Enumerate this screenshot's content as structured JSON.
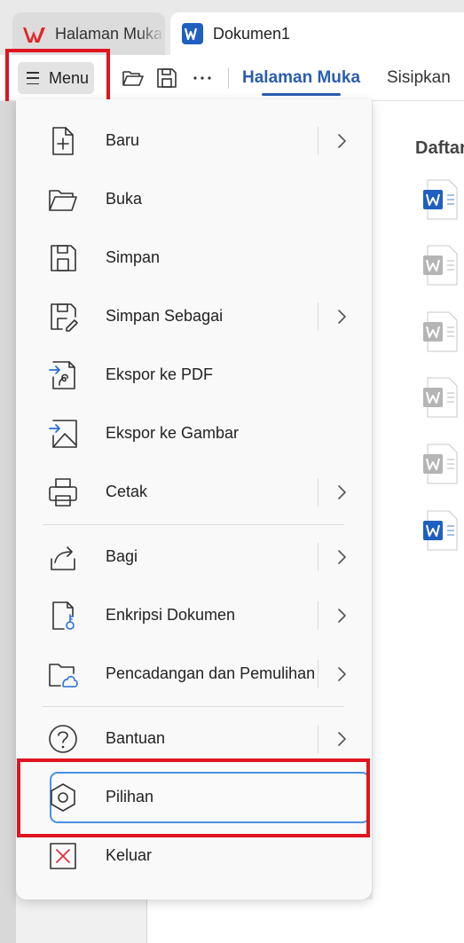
{
  "tabs": [
    {
      "label": "Halaman Muka",
      "state": "inactive",
      "icon": "wps-logo-icon"
    },
    {
      "label": "Dokumen1",
      "state": "active",
      "icon": "word-doc-icon"
    }
  ],
  "toolbar": {
    "menu_label": "Menu",
    "icons": [
      "open-folder-icon",
      "save-icon",
      "more-icon"
    ],
    "ribbon_tabs": [
      "Halaman Muka",
      "Sisipkan"
    ]
  },
  "content": {
    "title": "Daftar",
    "doc_icons": [
      "word-doc-icon",
      "word-doc-grey-icon",
      "word-doc-grey-icon",
      "word-doc-grey-icon",
      "word-doc-grey-icon",
      "word-doc-icon"
    ]
  },
  "menu": {
    "items": [
      {
        "label": "Baru",
        "icon": "new-document-icon",
        "submenu": true
      },
      {
        "label": "Buka",
        "icon": "open-folder-icon",
        "submenu": false
      },
      {
        "label": "Simpan",
        "icon": "save-icon",
        "submenu": false
      },
      {
        "label": "Simpan Sebagai",
        "icon": "save-as-icon",
        "submenu": true
      },
      {
        "label": "Ekspor ke PDF",
        "icon": "export-pdf-icon",
        "submenu": false
      },
      {
        "label": "Ekspor ke Gambar",
        "icon": "export-image-icon",
        "submenu": false
      },
      {
        "label": "Cetak",
        "icon": "printer-icon",
        "submenu": true
      },
      {
        "label": "Bagi",
        "icon": "share-icon",
        "submenu": true
      },
      {
        "label": "Enkripsi Dokumen",
        "icon": "encrypt-document-icon",
        "submenu": true
      },
      {
        "label": "Pencadangan dan Pemulihan",
        "icon": "backup-cloud-icon",
        "submenu": true
      },
      {
        "label": "Bantuan",
        "icon": "help-icon",
        "submenu": true
      },
      {
        "label": "Pilihan",
        "icon": "settings-hexagon-icon",
        "submenu": false,
        "selected": true
      },
      {
        "label": "Keluar",
        "icon": "exit-icon",
        "submenu": false
      }
    ]
  },
  "colors": {
    "accent": "#2a5db0",
    "highlight_box": "#e0141e",
    "selected_border": "#4a90e2",
    "word_blue": "#1f5fbf"
  }
}
